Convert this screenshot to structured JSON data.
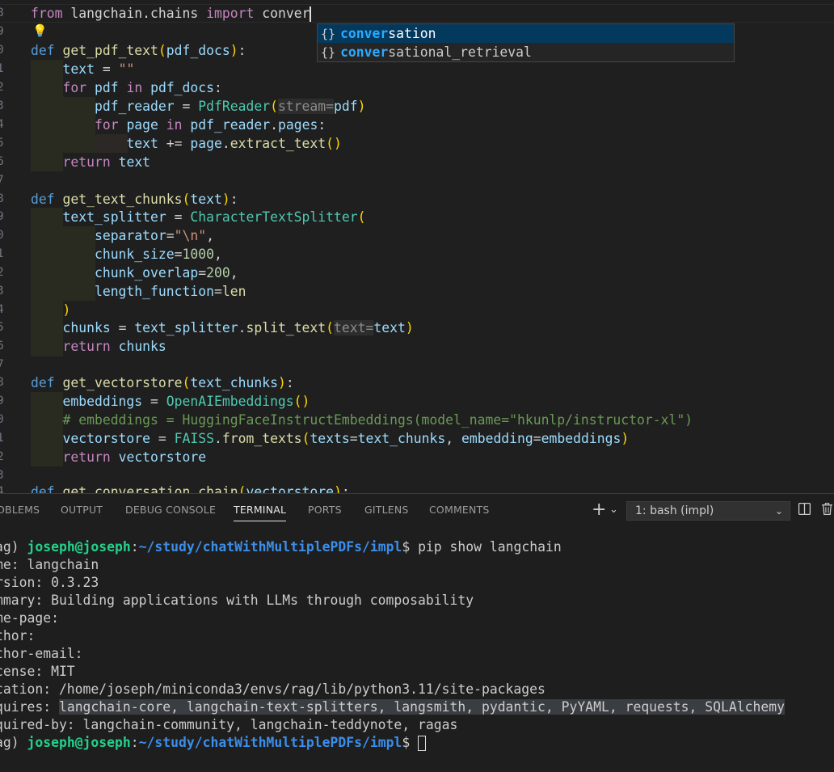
{
  "editor": {
    "line_numbers": [
      "8",
      "9",
      "0",
      "1",
      "2",
      "3",
      "4",
      "5",
      "6",
      "7",
      "8",
      "9",
      "0",
      "1",
      "2",
      "3",
      "4",
      "5",
      "6",
      "7",
      "8",
      "9",
      "0",
      "1",
      "2",
      "3",
      "4"
    ],
    "import_line": {
      "kw1": "from",
      "mod": "langchain.chains",
      "kw2": "import",
      "typed": "conver"
    },
    "suggestions": [
      {
        "icon": "{}",
        "match": "conver",
        "rest": "sation"
      },
      {
        "icon": "{}",
        "match": "conver",
        "rest": "sational_retrieval"
      }
    ]
  },
  "panel": {
    "tabs": [
      "OBLEMS",
      "OUTPUT",
      "DEBUG CONSOLE",
      "TERMINAL",
      "PORTS",
      "GITLENS",
      "COMMENTS"
    ],
    "active_tab": "TERMINAL",
    "terminal_selector": "1: bash (impl)",
    "add_symbol": "+",
    "dropdown_symbol": "⌄"
  },
  "terminal": {
    "prompt_env": "ag) ",
    "prompt_user": "joseph@joseph",
    "prompt_colon": ":",
    "prompt_path": "~/study/chatWithMultiplePDFs/impl",
    "prompt_dollar": "$ ",
    "command": "pip show langchain",
    "lines": [
      "me: langchain",
      "rsion: 0.3.23",
      "mmary: Building applications with LLMs through composability",
      "me-page:",
      "thor:",
      "thor-email:",
      "cense: MIT",
      "cation: /home/joseph/miniconda3/envs/rag/lib/python3.11/site-packages"
    ],
    "requires_label": "quires: ",
    "requires_value": "langchain-core, langchain-text-splitters, langsmith, pydantic, PyYAML, requests, SQLAlchemy",
    "required_by": "quired-by: langchain-community, langchain-teddynote, ragas"
  }
}
